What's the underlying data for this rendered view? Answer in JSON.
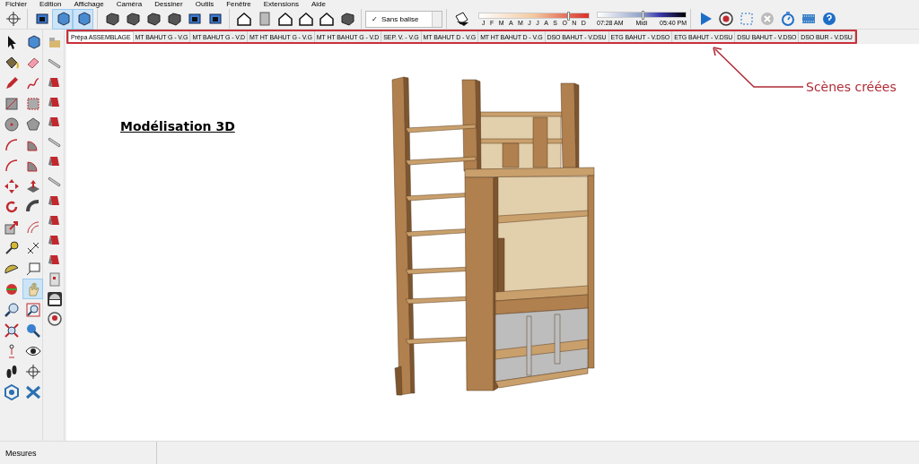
{
  "menu_bar": {
    "items": [
      "Fichier",
      "Edition",
      "Affichage",
      "Caméra",
      "Dessiner",
      "Outils",
      "Fenêtre",
      "Extensions",
      "Aide"
    ]
  },
  "main_toolbar": {
    "buttons": [
      {
        "pressed": false
      },
      {
        "pressed": false
      },
      {
        "pressed": true
      },
      {
        "pressed": true
      },
      {
        "pressed": false
      },
      {
        "pressed": false
      },
      {
        "pressed": false
      },
      {
        "pressed": false
      },
      {
        "pressed": false
      },
      {
        "pressed": false
      },
      {
        "pressed": false
      },
      {
        "pressed": false
      },
      {
        "pressed": false
      },
      {
        "pressed": false
      },
      {
        "pressed": false
      },
      {
        "pressed": false
      }
    ],
    "tag_dropdown": {
      "check": "✓",
      "value": "Sans balise"
    },
    "shadow_date": {
      "months": [
        "J",
        "F",
        "M",
        "A",
        "M",
        "J",
        "J",
        "A",
        "S",
        "O",
        "N",
        "D"
      ],
      "level": 0.8
    },
    "shadow_time": {
      "start": "07:28 AM",
      "middle": "Midi",
      "end": "05:40 PM",
      "level": 0.5
    },
    "animation_buttons": [
      {
        "pressed": false
      },
      {
        "pressed": false
      },
      {
        "pressed": false
      },
      {
        "pressed": false
      },
      {
        "pressed": false
      },
      {
        "pressed": false
      },
      {
        "pressed": false
      }
    ]
  },
  "scene_tabs": [
    {
      "label": "Prépa ASSEMBLAGE",
      "selected": true
    },
    {
      "label": "MT BAHUT G - V.G",
      "selected": false
    },
    {
      "label": "MT BAHUT G - V.D",
      "selected": false
    },
    {
      "label": "MT HT BAHUT G - V.G",
      "selected": false
    },
    {
      "label": "MT HT BAHUT G - V.D",
      "selected": false
    },
    {
      "label": "SEP. V. - V.G",
      "selected": false
    },
    {
      "label": "MT BAHUT D - V.G",
      "selected": false
    },
    {
      "label": "MT HT BAHUT D - V.G",
      "selected": false
    },
    {
      "label": "DSO BAHUT - V.DSU",
      "selected": false
    },
    {
      "label": "ETG BAHUT - V.DSO",
      "selected": false
    },
    {
      "label": "ETG BAHUT - V.DSU",
      "selected": false
    },
    {
      "label": "DSU BAHUT - V.DSO",
      "selected": false
    },
    {
      "label": "DSO BUR - V.DSU",
      "selected": false
    }
  ],
  "left_toolbar": {
    "buttons": [
      {
        "pressed": false
      },
      {
        "pressed": false
      },
      {
        "pressed": false
      },
      {
        "pressed": false
      },
      {
        "pressed": false
      },
      {
        "pressed": false
      },
      {
        "pressed": false
      },
      {
        "pressed": false
      },
      {
        "pressed": false
      },
      {
        "pressed": false
      },
      {
        "pressed": false
      },
      {
        "pressed": false
      },
      {
        "pressed": false
      },
      {
        "pressed": false
      },
      {
        "pressed": false
      },
      {
        "pressed": false
      },
      {
        "pressed": false
      },
      {
        "pressed": false
      },
      {
        "pressed": false
      },
      {
        "pressed": false
      },
      {
        "pressed": false
      },
      {
        "pressed": false
      },
      {
        "pressed": false
      },
      {
        "pressed": false
      },
      {
        "pressed": false
      },
      {
        "pressed": true
      },
      {
        "pressed": false
      },
      {
        "pressed": false
      },
      {
        "pressed": false
      },
      {
        "pressed": false
      },
      {
        "pressed": false
      },
      {
        "pressed": false
      },
      {
        "pressed": false
      },
      {
        "pressed": false
      },
      {
        "pressed": false
      },
      {
        "pressed": false
      }
    ]
  },
  "canvas": {
    "title": "Modélisation 3D",
    "annotation": "Scènes créées"
  },
  "status_bar": {
    "measurements_label": "Mesures"
  }
}
